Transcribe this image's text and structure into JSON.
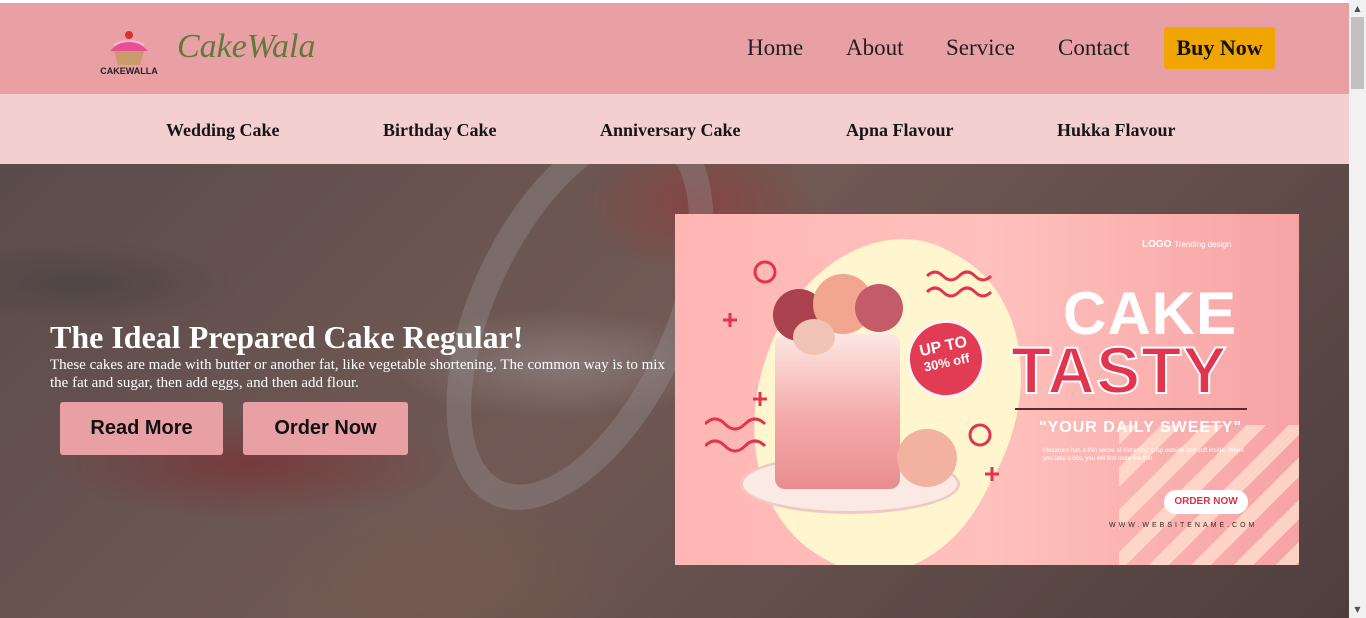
{
  "header": {
    "logo_text": "CAKEWALLA",
    "brand": "CakeWala",
    "nav": [
      "Home",
      "About",
      "Service",
      "Contact"
    ],
    "buy_now": "Buy Now"
  },
  "subnav": {
    "items": [
      "Wedding Cake",
      "Birthday Cake",
      "Anniversary Cake",
      "Apna Flavour",
      "Hukka Flavour"
    ]
  },
  "hero": {
    "title": "The Ideal Prepared Cake Regular!",
    "text": "These cakes are made with butter or another fat, like vegetable shortening. The common way is to mix the fat and sugar, then add eggs, and then add flour.",
    "read_more": "Read More",
    "order_now": "Order Now"
  },
  "promo": {
    "logo": "LOGO",
    "logo_sub": "Trending design",
    "badge_top": "UP TO",
    "badge_bottom": "30% off",
    "cake": "CAKE",
    "tasty": "TASTY",
    "tagline": "\"YOUR DAILY SWEETY\"",
    "small_text": "Macarons has a thin sense of hierarchy, crisp outside and soft inside. When you take a bite, you will first taste the thin",
    "order_button": "ORDER NOW",
    "website": "WWW.WEBSITENAME.COM"
  },
  "colors": {
    "header_bg": "#e8a0a4",
    "subnav_bg": "#f3cfd0",
    "brand_text": "#5f7a3a",
    "buy_button": "#f0a500",
    "hero_button": "#e8a0a4",
    "promo_accent": "#e0344f"
  }
}
